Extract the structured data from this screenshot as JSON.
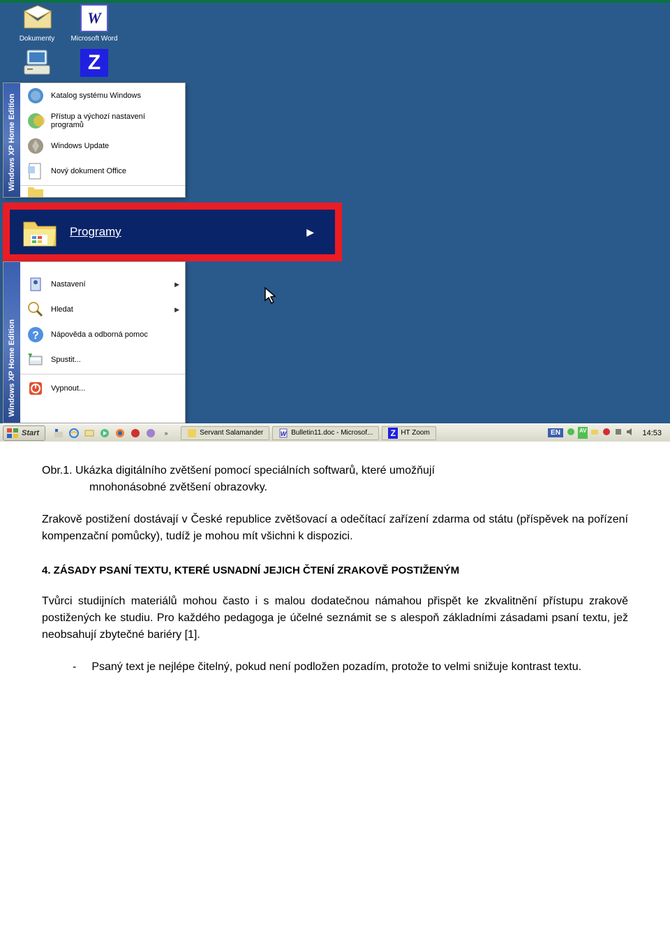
{
  "desktop_icons": {
    "documents": "Dokumenty",
    "word": "Microsoft Word",
    "word_glyph": "W"
  },
  "start_sidebar": "Windows XP  Home Edition",
  "start_menu": {
    "top_items": [
      {
        "label": "Katalog systému Windows",
        "icon": "catalog"
      },
      {
        "label": "Přístup a výchozí nastavení programů",
        "icon": "access"
      },
      {
        "label": "Windows Update",
        "icon": "update"
      },
      {
        "label": "Nový dokument Office",
        "icon": "office"
      }
    ],
    "highlighted": {
      "label": "Programy"
    },
    "bottom_items": [
      {
        "label": "Nastavení",
        "icon": "settings",
        "has_arrow": true
      },
      {
        "label": "Hledat",
        "icon": "search",
        "has_arrow": true
      },
      {
        "label": "Nápověda a odborná pomoc",
        "icon": "help"
      },
      {
        "label": "Spustit...",
        "icon": "run"
      },
      {
        "label": "Vypnout...",
        "icon": "shutdown"
      }
    ]
  },
  "taskbar": {
    "start": "Start",
    "items": [
      {
        "label": "Servant Salamander",
        "icon": "salamander"
      },
      {
        "label": "Bulletin11.doc - Microsof...",
        "icon": "word"
      },
      {
        "label": "HT Zoom",
        "icon": "z"
      }
    ],
    "lang": "EN",
    "av_badge": "AV",
    "time": "14:53"
  },
  "document": {
    "caption_line1": "Obr.1. Ukázka digitálního zvětšení pomocí speciálních softwarů, které umožňují",
    "caption_line2": "mnohonásobné zvětšení obrazovky.",
    "para1": "Zrakově postižení dostávají v České republice zvětšovací a odečítací zařízení zdarma od státu (příspěvek na pořízení kompenzační pomůcky), tudíž je mohou mít všichni k dispozici.",
    "heading": "4.   ZÁSADY PSANÍ TEXTU, KTERÉ USNADNÍ JEJICH ČTENÍ ZRAKOVĚ POSTIŽENÝM",
    "para2": "Tvůrci studijních materiálů mohou často i s malou dodatečnou námahou přispět ke zkvalitnění přístupu zrakově postižených ke studiu. Pro každého pedagoga je účelné seznámit se s alespoň základními zásadami psaní textu, jež neobsahují zbytečné bariéry [1].",
    "bullet1": "Psaný text je nejlépe čitelný, pokud není podložen pozadím, protože to velmi snižuje kontrast textu."
  }
}
